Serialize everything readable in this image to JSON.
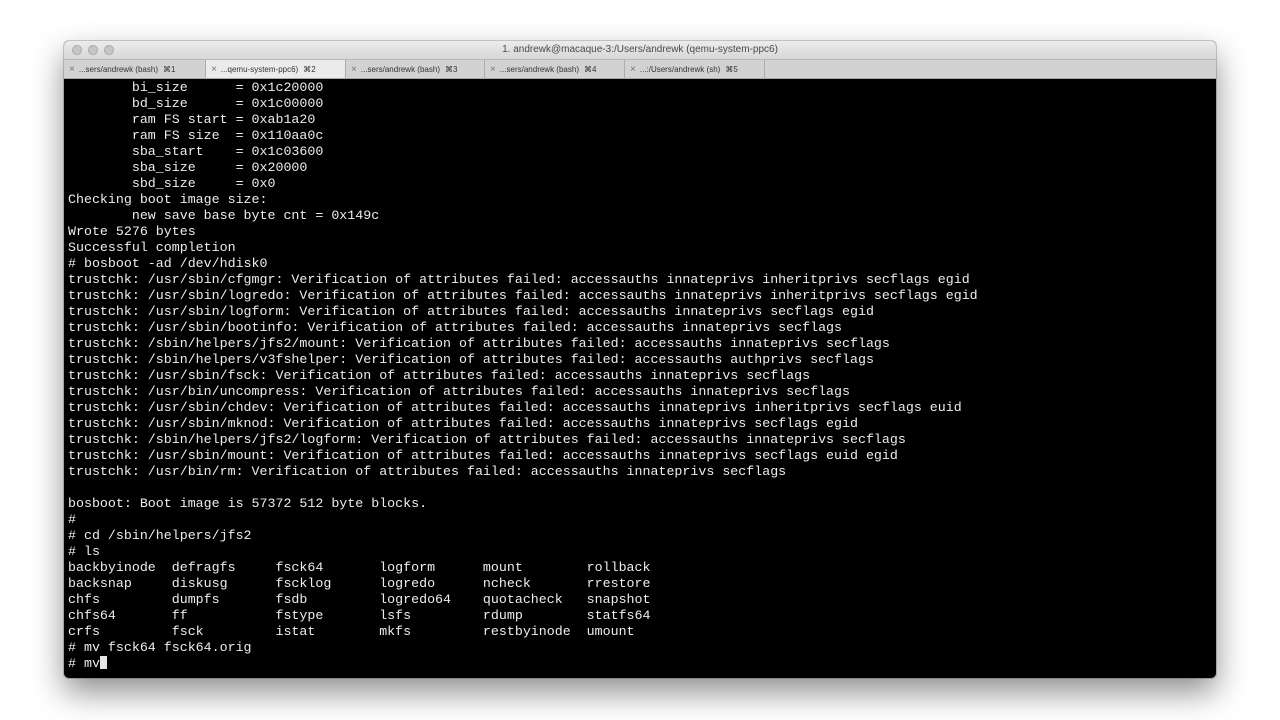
{
  "window": {
    "title": "1. andrewk@macaque-3:/Users/andrewk (qemu-system-ppc6)"
  },
  "tabs": [
    {
      "label": "...sers/andrewk (bash)",
      "shortcut": "⌘1",
      "active": false
    },
    {
      "label": "...qemu-system-ppc6)",
      "shortcut": "⌘2",
      "active": true
    },
    {
      "label": "...sers/andrewk (bash)",
      "shortcut": "⌘3",
      "active": false
    },
    {
      "label": "...sers/andrewk (bash)",
      "shortcut": "⌘4",
      "active": false
    },
    {
      "label": "...:/Users/andrewk (sh)",
      "shortcut": "⌘5",
      "active": false
    }
  ],
  "terminal": {
    "lines": [
      "        bi_size      = 0x1c20000",
      "        bd_size      = 0x1c00000",
      "        ram FS start = 0xab1a20",
      "        ram FS size  = 0x110aa0c",
      "        sba_start    = 0x1c03600",
      "        sba_size     = 0x20000",
      "        sbd_size     = 0x0",
      "Checking boot image size:",
      "        new save base byte cnt = 0x149c",
      "Wrote 5276 bytes",
      "Successful completion",
      "# bosboot -ad /dev/hdisk0",
      "trustchk: /usr/sbin/cfgmgr: Verification of attributes failed: accessauths innateprivs inheritprivs secflags egid",
      "trustchk: /usr/sbin/logredo: Verification of attributes failed: accessauths innateprivs inheritprivs secflags egid",
      "trustchk: /usr/sbin/logform: Verification of attributes failed: accessauths innateprivs secflags egid",
      "trustchk: /usr/sbin/bootinfo: Verification of attributes failed: accessauths innateprivs secflags",
      "trustchk: /sbin/helpers/jfs2/mount: Verification of attributes failed: accessauths innateprivs secflags",
      "trustchk: /sbin/helpers/v3fshelper: Verification of attributes failed: accessauths authprivs secflags",
      "trustchk: /usr/sbin/fsck: Verification of attributes failed: accessauths innateprivs secflags",
      "trustchk: /usr/bin/uncompress: Verification of attributes failed: accessauths innateprivs secflags",
      "trustchk: /usr/sbin/chdev: Verification of attributes failed: accessauths innateprivs inheritprivs secflags euid",
      "trustchk: /usr/sbin/mknod: Verification of attributes failed: accessauths innateprivs secflags egid",
      "trustchk: /sbin/helpers/jfs2/logform: Verification of attributes failed: accessauths innateprivs secflags",
      "trustchk: /usr/sbin/mount: Verification of attributes failed: accessauths innateprivs secflags euid egid",
      "trustchk: /usr/bin/rm: Verification of attributes failed: accessauths innateprivs secflags",
      "",
      "bosboot: Boot image is 57372 512 byte blocks.",
      "#",
      "# cd /sbin/helpers/jfs2",
      "# ls",
      "backbyinode  defragfs     fsck64       logform      mount        rollback",
      "backsnap     diskusg      fscklog      logredo      ncheck       rrestore",
      "chfs         dumpfs       fsdb         logredo64    quotacheck   snapshot",
      "chfs64       ff           fstype       lsfs         rdump        statfs64",
      "crfs         fsck         istat        mkfs         restbyinode  umount",
      "# mv fsck64 fsck64.orig"
    ],
    "current_input": "# mv"
  }
}
